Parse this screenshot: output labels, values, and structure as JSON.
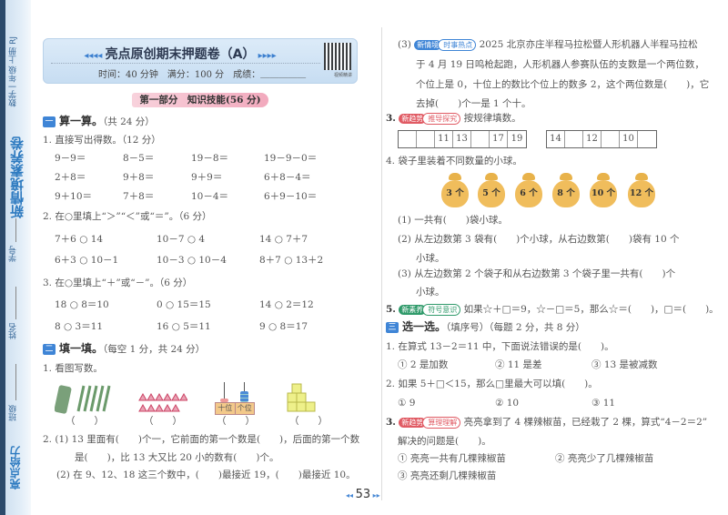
{
  "sidebar": {
    "series": "数学一年级 上册 RJ",
    "title": "新情境素养卷",
    "student_id_label": "学号",
    "name_label": "姓名",
    "class_label": "班级",
    "brand": "亮点给力"
  },
  "header": {
    "title": "亮点原创期末押题卷（A）",
    "time": "时间：40 分钟",
    "full_score": "满分：100 分",
    "score_label": "成绩：",
    "qr_label": "视频精讲"
  },
  "part_one": "第一部分　知识技能(56 分)",
  "sec1": {
    "no": "一",
    "title": "算一算。",
    "note": "（共 24 分）",
    "q1": "1. 直接写出得数。（12 分）",
    "q1_items": [
      "9－9＝",
      "8－5＝",
      "19－8＝",
      "19－9－0＝",
      "2＋8＝",
      "9＋8＝",
      "9＋9＝",
      "6＋8－4＝",
      "9＋10＝",
      "7＋8＝",
      "10－4＝",
      "6＋9－10＝"
    ],
    "q2": "2. 在○里填上“＞”“＜”或“＝”。（6 分）",
    "q2_items": [
      "7＋6 ○ 14",
      "10－7 ○ 4",
      "14 ○ 7＋7",
      "6＋3 ○ 10－1",
      "10－3 ○ 10－4",
      "8＋7 ○ 13＋2"
    ],
    "q3": "3. 在○里填上“＋”或“－”。（6 分）",
    "q3_items": [
      "18 ○ 8＝10",
      "0 ○ 15＝15",
      "14 ○ 2＝12",
      "8 ○ 3＝11",
      "16 ○ 5＝11",
      "9 ○ 8＝17"
    ]
  },
  "sec2": {
    "no": "二",
    "title": "填一填。",
    "note": "（每空 1 分，共 24 分）",
    "q1": "1. 看图写数。",
    "answer_blank": "（　　）",
    "abacus_tens": "十位",
    "abacus_ones": "个位",
    "q2_1a": "2. (1) 13 里面有(　　)个一，它前面的第一个数是(　　)，后面的第一个数",
    "q2_1b": "是(　　)，比 13 大又比 20 小的数有(　　)个。",
    "q2_2": "(2) 在 9、12、18 这三个数中，(　　)最接近 19，(　　)最接近 10。",
    "q2_3_no": "(3)",
    "q2_3_badge": "新情境",
    "q2_3_tag": "时事热点",
    "q2_3a": "2025 北京亦庄半程马拉松暨人形机器人半程马拉松",
    "q2_3b": "于 4 月 19 日鸣枪起跑，人形机器人参赛队伍的支数是一个两位数，",
    "q2_3c": "个位上是 0，十位上的数比个位上的数多 2，这个两位数是(　　)，它",
    "q2_3d": "去掉(　　)个一是 1 个十。",
    "q3_no": "3.",
    "q3_badge": "新趋势",
    "q3_tag": "推导探究",
    "q3": "按规律填数。",
    "seq1": [
      "",
      "",
      "11",
      "13",
      "",
      "17",
      "19"
    ],
    "seq2": [
      "14",
      "",
      "12",
      "",
      "10",
      ""
    ],
    "q4": "4. 袋子里装着不同数量的小球。",
    "bags": [
      "3 个",
      "5 个",
      "6 个",
      "8 个",
      "10 个",
      "12 个"
    ],
    "q4_1": "(1) 一共有(　　)袋小球。",
    "q4_2a": "(2) 从左边数第 3 袋有(　　)个小球，从右边数第(　　)袋有 10 个",
    "q4_2b": "小球。",
    "q4_3a": "(3) 从左边数第 2 个袋子和从右边数第 3 个袋子里一共有(　　)个",
    "q4_3b": "小球。",
    "q5_no": "5.",
    "q5_badge": "新素养",
    "q5_tag": "符号意识",
    "q5": "如果☆＋□＝9，☆－□＝5，那么☆＝(　　)，□＝(　　)。"
  },
  "sec3": {
    "no": "三",
    "title": "选一选。",
    "note": "（填序号）（每题 2 分，共 8 分）",
    "q1": "1. 在算式 13－2＝11 中，下面说法错误的是(　　)。",
    "q1_opts": [
      "① 2 是加数",
      "② 11 是差",
      "③ 13 是被减数"
    ],
    "q2": "2. 如果 5＋□＜15，那么□里最大可以填(　　)。",
    "q2_opts": [
      "① 9",
      "② 10",
      "③ 11"
    ],
    "q3_no": "3.",
    "q3_badge": "新趋势",
    "q3_tag": "算理理解",
    "q3a": "亮亮拿到了 4 棵辣椒苗，已经栽了 2 棵，算式“4－2＝2”",
    "q3b": "解决的问题是(　　)。",
    "q3_opts": [
      "① 亮亮一共有几棵辣椒苗",
      "② 亮亮少了几棵辣椒苗",
      "③ 亮亮还剩几棵辣椒苗"
    ]
  },
  "page_number": "53",
  "colors": {
    "blue": "#3f85d6",
    "red": "#e05a63",
    "green": "#2f9a6a",
    "pink": "#f2a9bd"
  }
}
